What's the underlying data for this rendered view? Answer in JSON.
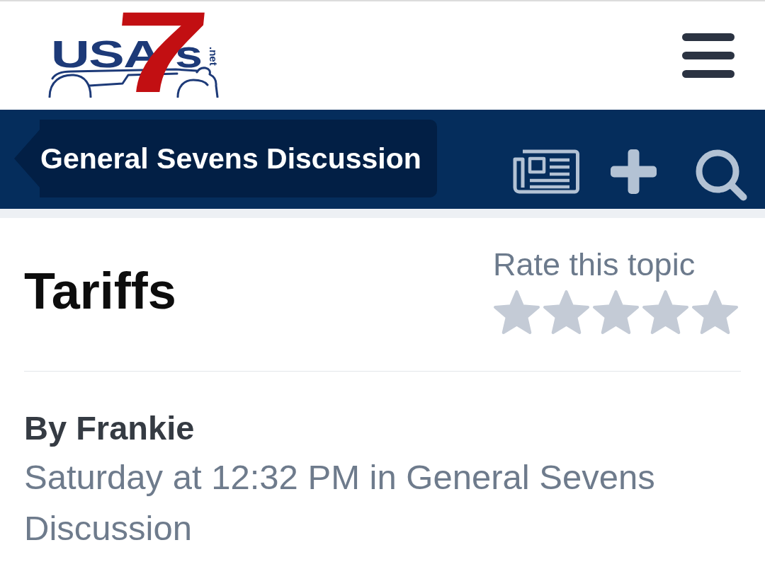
{
  "header": {
    "logo": {
      "name": "USA",
      "numeral": "7",
      "suffix": "s",
      "domain": ".net"
    }
  },
  "navigation": {
    "breadcrumb": "General Sevens Discussion"
  },
  "topic": {
    "title": "Tariffs",
    "rating": {
      "label": "Rate this topic",
      "stars": 0
    },
    "author": "By Frankie",
    "meta": "Saturday at 12:32 PM in General Sevens Discussion"
  }
}
